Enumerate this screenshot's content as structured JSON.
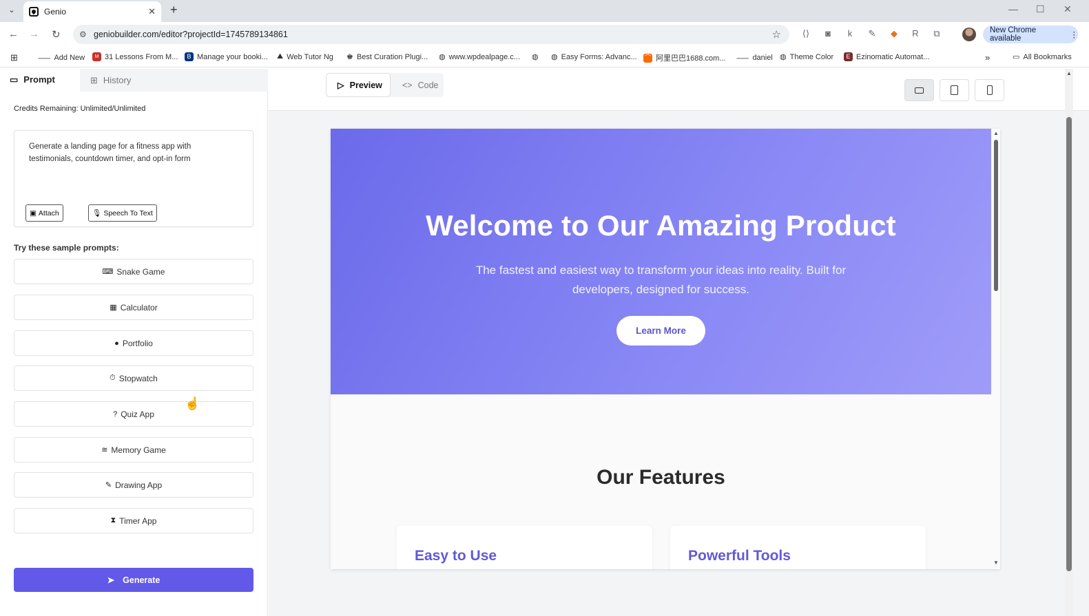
{
  "browser": {
    "tab_title": "Genio",
    "tab_close": "✕",
    "new_tab": "+",
    "url": "geniobuilder.com/editor?projectId=1745789134861",
    "new_chrome_label": "New Chrome available",
    "bookmarks": [
      {
        "label": "Add New"
      },
      {
        "label": "31 Lessons From M..."
      },
      {
        "label": "Manage your booki..."
      },
      {
        "label": "Web Tutor Ng"
      },
      {
        "label": "Best Curation Plugi..."
      },
      {
        "label": "www.wpdealpage.c..."
      },
      {
        "label": ""
      },
      {
        "label": "Easy Forms: Advanc..."
      },
      {
        "label": "阿里巴巴1688.com..."
      },
      {
        "label": "daniel"
      },
      {
        "label": "Theme Color"
      },
      {
        "label": "Ezinomatic Automat..."
      }
    ],
    "all_bookmarks": "All Bookmarks",
    "overflow": "»"
  },
  "left_panel": {
    "tabs": [
      {
        "label": "Prompt"
      },
      {
        "label": "History"
      }
    ],
    "credits": "Credits Remaining: Unlimited/Unlimited",
    "prompt_text": "Generate a landing page for a fitness app with testimonials, countdown timer, and opt-in form",
    "attach_label": "Attach",
    "speech_label": "Speech To Text",
    "try_label": "Try these sample prompts:",
    "samples": [
      {
        "label": "Snake Game",
        "icon": "gamepad-icon"
      },
      {
        "label": "Calculator",
        "icon": "calculator-icon"
      },
      {
        "label": "Portfolio",
        "icon": "user-circle-icon"
      },
      {
        "label": "Stopwatch",
        "icon": "stopwatch-icon"
      },
      {
        "label": "Quiz App",
        "icon": "question-circle-icon"
      },
      {
        "label": "Memory Game",
        "icon": "layers-icon"
      },
      {
        "label": "Drawing App",
        "icon": "brush-icon"
      },
      {
        "label": "Timer App",
        "icon": "hourglass-icon"
      }
    ],
    "generate_label": "Generate"
  },
  "editor": {
    "view_tabs": [
      {
        "label": "Preview"
      },
      {
        "label": "Code"
      }
    ],
    "devices": [
      "laptop-icon",
      "tablet-icon",
      "phone-icon"
    ]
  },
  "preview": {
    "hero_title": "Welcome to Our Amazing Product",
    "hero_subtitle": "The fastest and easiest way to transform your ideas into reality. Built for developers, designed for success.",
    "cta_label": "Learn More",
    "features_title": "Our Features",
    "cards": [
      {
        "title": "Easy to Use"
      },
      {
        "title": "Powerful Tools"
      }
    ],
    "colors": {
      "hero_start": "#6b6aea",
      "hero_end": "#9f9cf8",
      "accent": "#6259e8"
    }
  }
}
